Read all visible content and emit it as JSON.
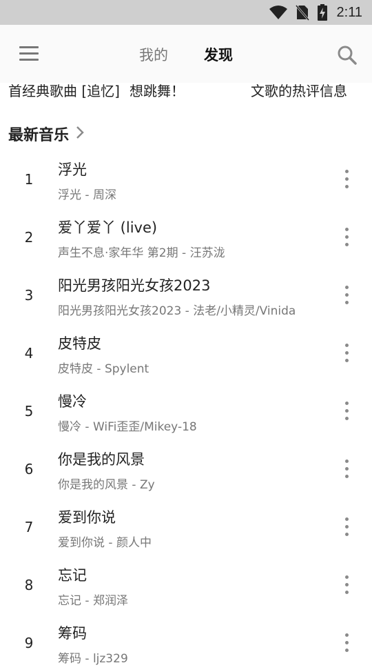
{
  "status_bar": {
    "time": "2:11",
    "icons": [
      "wifi-icon",
      "no-sim-icon",
      "battery-charging-icon"
    ]
  },
  "header": {
    "menu_icon": "hamburger-menu-icon",
    "search_icon": "search-icon",
    "tabs": [
      {
        "label": "我的",
        "active": false
      },
      {
        "label": "发现",
        "active": true
      }
    ]
  },
  "banners": [
    {
      "text": "首经典歌曲 [追忆]"
    },
    {
      "text": "想跳舞！"
    },
    {
      "text": "文歌的热评信息"
    }
  ],
  "section": {
    "title": "最新音乐",
    "arrow_icon": "chevron-right-icon"
  },
  "songs": [
    {
      "index": "1",
      "title": "浮光",
      "subtitle": "浮光 - 周深"
    },
    {
      "index": "2",
      "title": "爱丫爱丫 (live)",
      "subtitle": "声生不息·家年华 第2期 - 汪苏泷"
    },
    {
      "index": "3",
      "title": "阳光男孩阳光女孩2023",
      "subtitle": "阳光男孩阳光女孩2023 - 法老/小精灵/Vinida"
    },
    {
      "index": "4",
      "title": "皮特皮",
      "subtitle": "皮特皮 - Spylent"
    },
    {
      "index": "5",
      "title": "慢冷",
      "subtitle": "慢冷 - WiFi歪歪/Mikey-18"
    },
    {
      "index": "6",
      "title": "你是我的风景",
      "subtitle": "你是我的风景 - Zy"
    },
    {
      "index": "7",
      "title": "爱到你说",
      "subtitle": "爱到你说 - 颜人中"
    },
    {
      "index": "8",
      "title": "忘记",
      "subtitle": "忘记 - 郑润泽"
    },
    {
      "index": "9",
      "title": "筹码",
      "subtitle": "筹码 - ljz329"
    }
  ],
  "colors": {
    "status_bar_bg": "#cfcfcf",
    "app_bar_bg": "#fafafa",
    "primary_text": "#222222",
    "secondary_text": "#777777",
    "icon_gray": "#8a8a8a"
  }
}
